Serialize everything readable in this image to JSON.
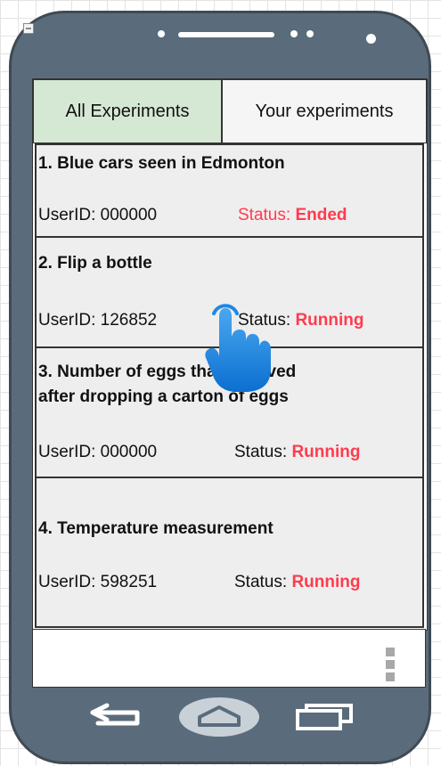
{
  "tabs": [
    {
      "label": "All Experiments",
      "active": true
    },
    {
      "label": "Your experiments",
      "active": false
    }
  ],
  "experiments": [
    {
      "title_lines": [
        "1. Blue cars seen in Edmonton"
      ],
      "userid": "UserID: 000000",
      "status_label": "Status:",
      "status_value": "Ended"
    },
    {
      "title_lines": [
        "2. Flip a bottle"
      ],
      "userid": "UserID: 126852",
      "status_label": "Status:",
      "status_value": "Running"
    },
    {
      "title_lines": [
        "3. Number of eggs that survived",
        "after dropping a carton of eggs"
      ],
      "userid": "UserID: 000000",
      "status_label": "Status:",
      "status_value": "Running"
    },
    {
      "title_lines": [
        "4. Temperature measurement"
      ],
      "userid": "UserID: 598251",
      "status_label": "Status:",
      "status_value": "Running"
    }
  ],
  "colors": {
    "phone_body": "#5a6c7b",
    "tab_active": "#d5e8d4",
    "card_bg": "#eeeeee",
    "status_red": "#ff3b4e",
    "cursor_blue": "#1e88e5"
  },
  "icons": {
    "overflow_menu": "vertical-dots-icon",
    "back": "back-arrow-icon",
    "home": "home-icon",
    "recents": "recent-apps-icon",
    "pointer": "hand-pointer-icon"
  }
}
